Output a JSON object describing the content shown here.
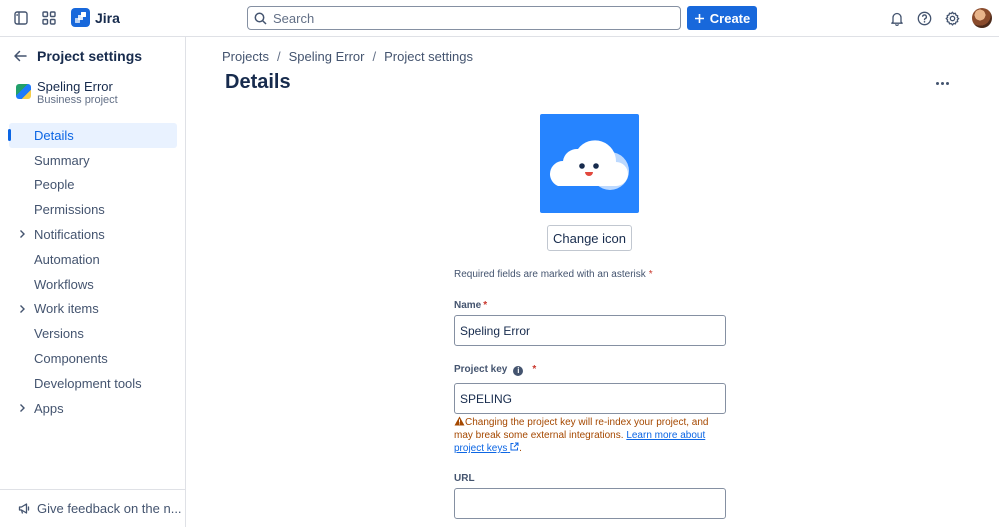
{
  "topbar": {
    "app_name": "Jira",
    "search_placeholder": "Search",
    "create_label": "Create",
    "icons": [
      "sidebar-toggle-icon",
      "app-switcher-icon",
      "bell-icon",
      "help-icon",
      "settings-icon"
    ]
  },
  "sidebar": {
    "title": "Project settings",
    "project_name": "Speling Error",
    "project_type": "Business project",
    "items": [
      {
        "label": "Details",
        "active": true,
        "expandable": false
      },
      {
        "label": "Summary",
        "active": false,
        "expandable": false
      },
      {
        "label": "People",
        "active": false,
        "expandable": false
      },
      {
        "label": "Permissions",
        "active": false,
        "expandable": false
      },
      {
        "label": "Notifications",
        "active": false,
        "expandable": true
      },
      {
        "label": "Automation",
        "active": false,
        "expandable": false
      },
      {
        "label": "Workflows",
        "active": false,
        "expandable": false
      },
      {
        "label": "Work items",
        "active": false,
        "expandable": true
      },
      {
        "label": "Versions",
        "active": false,
        "expandable": false
      },
      {
        "label": "Components",
        "active": false,
        "expandable": false
      },
      {
        "label": "Development tools",
        "active": false,
        "expandable": false
      },
      {
        "label": "Apps",
        "active": false,
        "expandable": true
      }
    ],
    "feedback_label": "Give feedback on the n..."
  },
  "main": {
    "breadcrumbs": [
      "Projects",
      "Speling Error",
      "Project settings"
    ],
    "title": "Details",
    "change_icon_label": "Change icon",
    "required_note": "Required fields are marked with an asterisk",
    "fields": {
      "name": {
        "label": "Name",
        "value": "Speling Error"
      },
      "key": {
        "label": "Project key",
        "value": "SPELING"
      },
      "url": {
        "label": "URL",
        "value": ""
      }
    },
    "warning": {
      "text": "Changing the project key will re-index your project, and may break some external integrations.",
      "link_text": "Learn more about project keys",
      "suffix": "."
    }
  },
  "colors": {
    "brand": "#1868db",
    "active_nav": "#0c66e4",
    "warning_text": "#a54800",
    "project_avatar_bg": "#2684ff"
  }
}
